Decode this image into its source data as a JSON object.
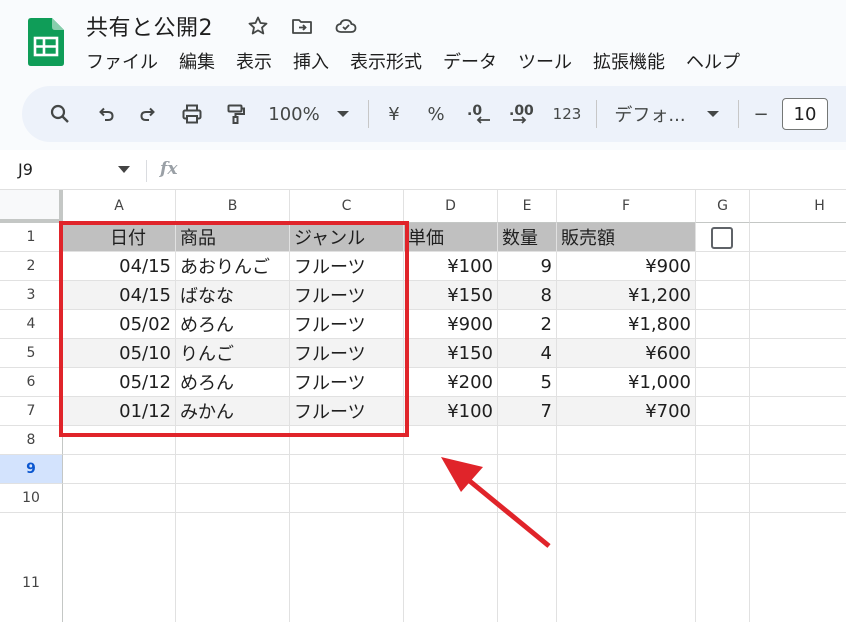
{
  "app": {
    "title": "共有と公開2",
    "menu": [
      "ファイル",
      "編集",
      "表示",
      "挿入",
      "表示形式",
      "データ",
      "ツール",
      "拡張機能",
      "ヘルプ"
    ]
  },
  "toolbar": {
    "zoom": "100%",
    "currency": "¥",
    "percent": "%",
    "number_format": "123",
    "font_name": "デフォ...",
    "font_size": "10",
    "minus": "−"
  },
  "formula_bar": {
    "name_box": "J9",
    "fx": "fx"
  },
  "columns": [
    "A",
    "B",
    "C",
    "D",
    "E",
    "F",
    "G",
    "H"
  ],
  "rows": [
    "1",
    "2",
    "3",
    "4",
    "5",
    "6",
    "7",
    "8",
    "9",
    "10",
    "11"
  ],
  "active_row": "9",
  "table": {
    "headers": [
      "日付",
      "商品",
      "ジャンル",
      "単価",
      "数量",
      "販売額"
    ],
    "rows": [
      [
        "04/15",
        "あおりんご",
        "フルーツ",
        "¥100",
        "9",
        "¥900"
      ],
      [
        "04/15",
        "ばなな",
        "フルーツ",
        "¥150",
        "8",
        "¥1,200"
      ],
      [
        "05/02",
        "めろん",
        "フルーツ",
        "¥900",
        "2",
        "¥1,800"
      ],
      [
        "05/10",
        "りんご",
        "フルーツ",
        "¥150",
        "4",
        "¥600"
      ],
      [
        "05/12",
        "めろん",
        "フルーツ",
        "¥200",
        "5",
        "¥1,000"
      ],
      [
        "01/12",
        "みかん",
        "フルーツ",
        "¥100",
        "7",
        "¥700"
      ]
    ]
  },
  "colors": {
    "header_fill": "#c0c0c0",
    "alt_fill": "#f3f3f3",
    "annotation": "#e0242a",
    "sheets_green": "#0f9d58"
  }
}
